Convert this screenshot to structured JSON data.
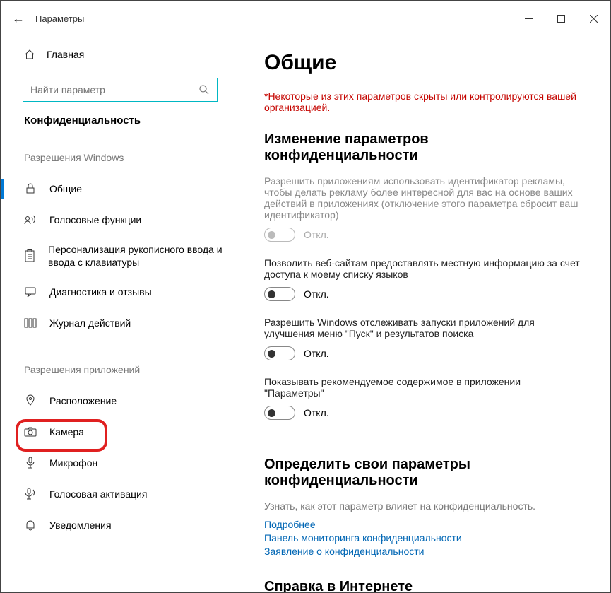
{
  "titlebar": {
    "back": "←",
    "title": "Параметры"
  },
  "sidebar": {
    "home": "Главная",
    "search_placeholder": "Найти параметр",
    "category": "Конфиденциальность",
    "group1_header": "Разрешения Windows",
    "group1": {
      "general": "Общие",
      "speech": "Голосовые функции",
      "inking": "Персонализация рукописного ввода и ввода с клавиатуры",
      "diagnostics": "Диагностика и отзывы",
      "activity": "Журнал действий"
    },
    "group2_header": "Разрешения приложений",
    "group2": {
      "location": "Расположение",
      "camera": "Камера",
      "microphone": "Микрофон",
      "voice": "Голосовая активация",
      "notifications": "Уведомления"
    }
  },
  "main": {
    "title": "Общие",
    "warning": "*Некоторые из этих параметров скрыты или контролируются вашей организацией.",
    "section1_heading": "Изменение параметров конфиденциальности",
    "settings": {
      "s1": {
        "desc": "Разрешить приложениям использовать идентификатор рекламы, чтобы делать рекламу более интересной для вас на основе ваших действий в приложениях (отключение этого параметра сбросит ваш идентификатор)",
        "state": "Откл."
      },
      "s2": {
        "desc": "Позволить веб-сайтам предоставлять местную информацию за счет доступа к моему списку языков",
        "state": "Откл."
      },
      "s3": {
        "desc": "Разрешить Windows отслеживать запуски приложений для улучшения меню \"Пуск\" и результатов поиска",
        "state": "Откл."
      },
      "s4": {
        "desc": "Показывать рекомендуемое содержимое в приложении \"Параметры\"",
        "state": "Откл."
      }
    },
    "section2_heading": "Определить свои параметры конфиденциальности",
    "section2_sub": "Узнать, как этот параметр влияет на конфиденциальность.",
    "links": {
      "l1": "Подробнее",
      "l2": "Панель мониторинга конфиденциальности",
      "l3": "Заявление о конфиденциальности"
    },
    "section3_heading": "Справка в Интернете"
  }
}
